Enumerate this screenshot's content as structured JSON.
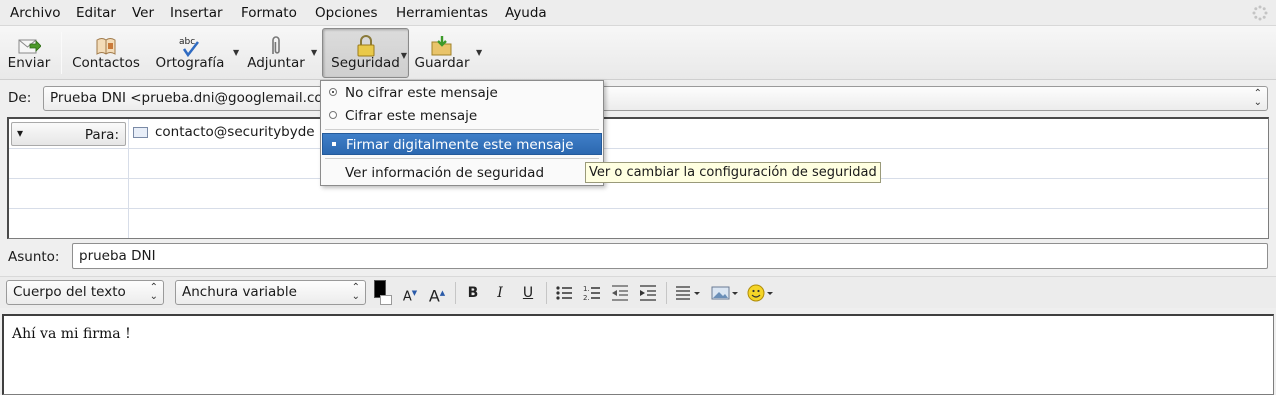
{
  "menubar": {
    "items": [
      {
        "label": "Archivo"
      },
      {
        "label": "Editar"
      },
      {
        "label": "Ver"
      },
      {
        "label": "Insertar"
      },
      {
        "label": "Formato"
      },
      {
        "label": "Opciones"
      },
      {
        "label": "Herramientas"
      },
      {
        "label": "Ayuda"
      }
    ]
  },
  "toolbar": {
    "enviar": "Enviar",
    "contactos": "Contactos",
    "ortografia": "Ortografía",
    "adjuntar": "Adjuntar",
    "seguridad": "Seguridad",
    "guardar": "Guardar",
    "spell_icon_text": "abc"
  },
  "header": {
    "from_label": "De:",
    "from_value": "Prueba DNI <prueba.dni@googlemail.co",
    "to_button": "Para:",
    "to_value": "contacto@securitybyde",
    "subject_label": "Asunto:",
    "subject_value": "prueba DNI"
  },
  "format_toolbar": {
    "paragraph_style": "Cuerpo del texto",
    "font": "Anchura variable",
    "bold": "B",
    "italic": "I",
    "underline": "U"
  },
  "body": {
    "text": "Ahí va mi firma !"
  },
  "security_menu": {
    "items": [
      {
        "label": "No cifrar este mensaje",
        "type": "radio",
        "checked": true
      },
      {
        "label": "Cifrar este mensaje",
        "type": "radio",
        "checked": false
      },
      {
        "label": "Firmar digitalmente este mensaje",
        "type": "check",
        "checked": true,
        "highlighted": true
      },
      {
        "label": "Ver información de seguridad",
        "type": "action"
      }
    ]
  },
  "tooltip": {
    "text": "Ver o cambiar la configuración de seguridad"
  },
  "colors": {
    "highlight": "#2f6db5",
    "tooltip_bg": "#ffffe1",
    "pressed_button": "#d3d3d3"
  }
}
